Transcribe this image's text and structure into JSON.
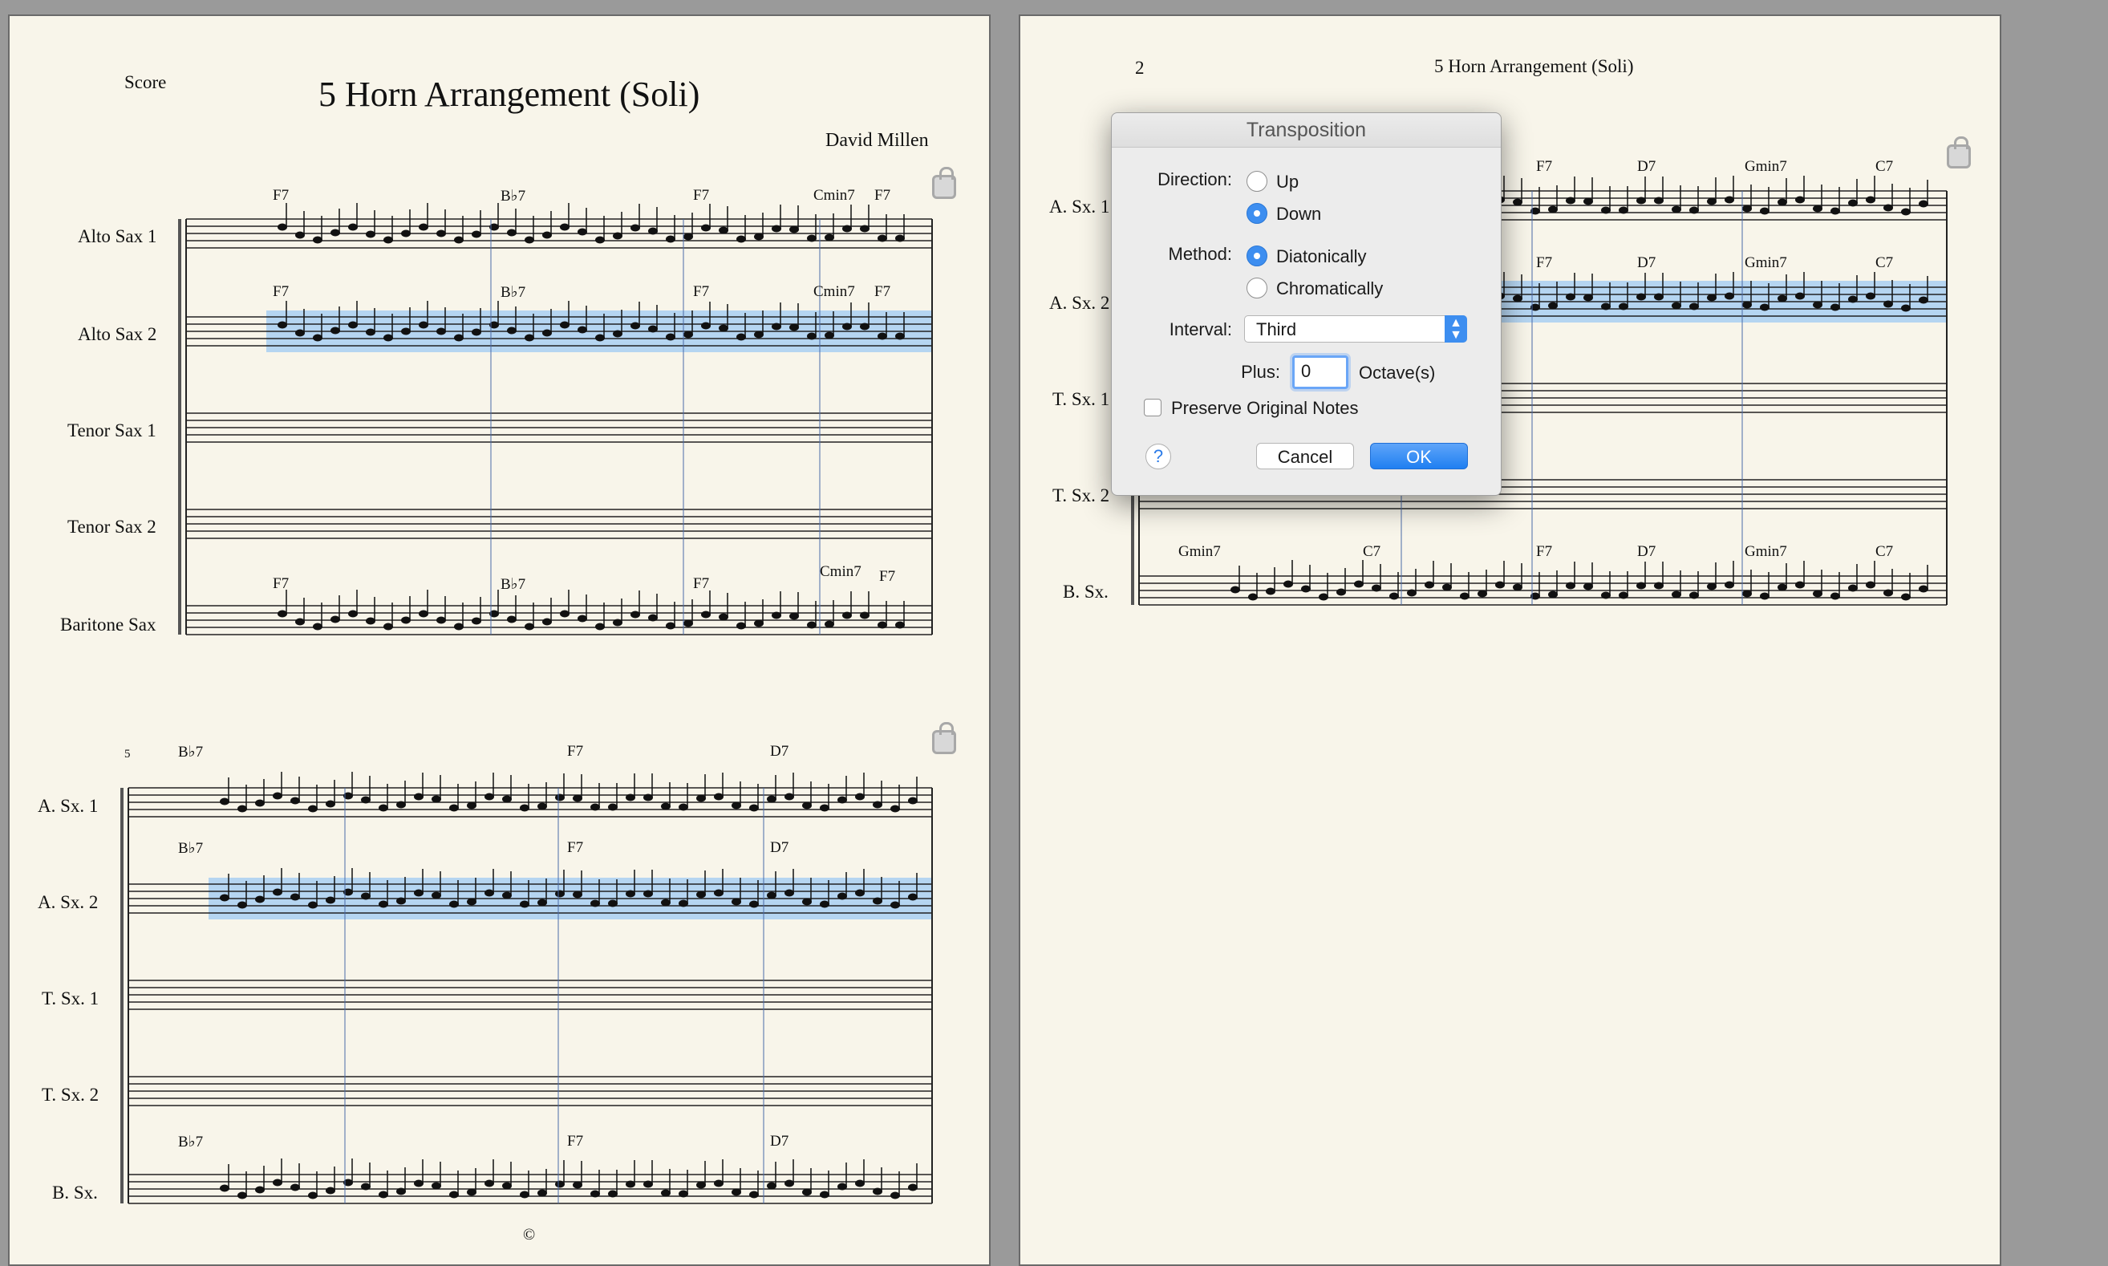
{
  "page1": {
    "score_label": "Score",
    "title": "5 Horn Arrangement (Soli)",
    "composer": "David Millen",
    "system1": {
      "instruments": [
        "Alto Sax 1",
        "Alto Sax 2",
        "Tenor Sax 1",
        "Tenor Sax 2",
        "Baritone Sax"
      ],
      "chords_alto1": [
        "F7",
        "B♭7",
        "F7",
        "Cmin7",
        "F7"
      ],
      "chords_alto2": [
        "F7",
        "B♭7",
        "F7",
        "Cmin7",
        "F7"
      ],
      "chords_bari": [
        "F7",
        "B♭7",
        "F7",
        "Cmin7",
        "F7"
      ]
    },
    "system2": {
      "measure_number": "5",
      "instruments": [
        "A. Sx. 1",
        "A. Sx. 2",
        "T. Sx. 1",
        "T. Sx. 2",
        "B. Sx."
      ],
      "chords_alto1": [
        "B♭7",
        "F7",
        "D7"
      ],
      "chords_alto2": [
        "B♭7",
        "F7",
        "D7"
      ],
      "chords_bari": [
        "B♭7",
        "F7",
        "D7"
      ]
    },
    "copyright": "©"
  },
  "page2": {
    "page_number": "2",
    "header_title": "5 Horn Arrangement (Soli)",
    "instruments": [
      "A. Sx. 1",
      "A. Sx. 2",
      "T. Sx. 1",
      "T. Sx. 2",
      "B. Sx."
    ],
    "chords_alto1": [
      "F7",
      "D7",
      "Gmin7",
      "C7"
    ],
    "chords_alto2": [
      "F7",
      "D7",
      "Gmin7",
      "C7"
    ],
    "chords_bari": [
      "Gmin7",
      "C7",
      "F7",
      "D7",
      "Gmin7",
      "C7"
    ]
  },
  "dialog": {
    "title": "Transposition",
    "direction_label": "Direction:",
    "direction_options": [
      "Up",
      "Down"
    ],
    "direction_selected": "Down",
    "method_label": "Method:",
    "method_options": [
      "Diatonically",
      "Chromatically"
    ],
    "method_selected": "Diatonically",
    "interval_label": "Interval:",
    "interval_value": "Third",
    "plus_label": "Plus:",
    "plus_value": "0",
    "octaves_label": "Octave(s)",
    "preserve_label": "Preserve Original Notes",
    "preserve_checked": false,
    "help_glyph": "?",
    "cancel_label": "Cancel",
    "ok_label": "OK"
  },
  "colors": {
    "selection": "#a9cff2",
    "accent": "#2b7be8",
    "paper": "#f8f5ea"
  },
  "icons": [
    "lock-icon",
    "help-icon",
    "popup-arrows-icon"
  ]
}
